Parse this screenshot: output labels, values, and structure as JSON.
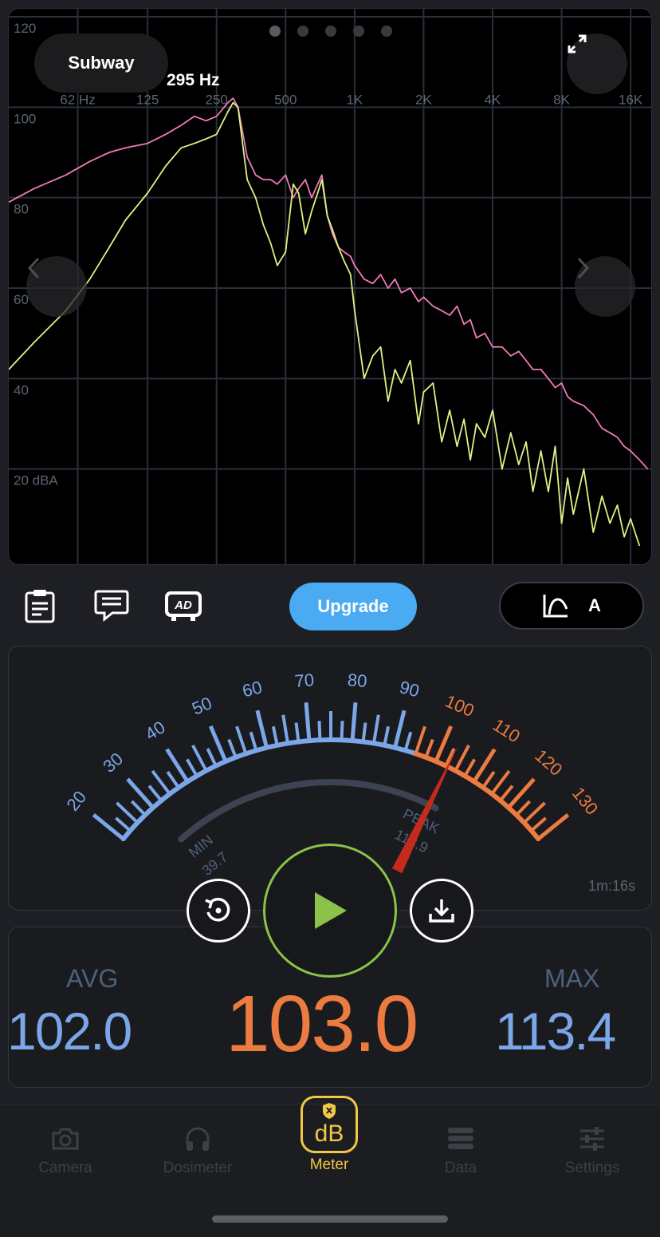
{
  "spectrum": {
    "location_label": "Subway",
    "peak_label": "295 Hz",
    "page_dots": 5,
    "active_dot": 0,
    "y_ticks": [
      "120",
      "100",
      "80",
      "60",
      "40",
      "20 dBA"
    ],
    "x_ticks": [
      "62 Hz",
      "125",
      "250",
      "500",
      "1K",
      "2K",
      "4K",
      "8K",
      "16K"
    ],
    "colors": {
      "max_line": "#f07ab8",
      "live_line": "#ddf383",
      "grid": "#2b2f3b",
      "labels": "#5c6472"
    },
    "chart_data": {
      "type": "line",
      "x_scale": "log",
      "xlim": [
        31,
        20000
      ],
      "ylim": [
        0,
        120
      ],
      "ylabel": "dBA",
      "series": [
        {
          "values_x": [
            31,
            40,
            55,
            70,
            85,
            100,
            125,
            150,
            175,
            200,
            225,
            250,
            280,
            295,
            310,
            340,
            370,
            400,
            430,
            460,
            500,
            540,
            570,
            610,
            650,
            690,
            720,
            760,
            800,
            850,
            900,
            960,
            1000,
            1100,
            1200,
            1300,
            1400,
            1500,
            1600,
            1750,
            1900,
            2000,
            2200,
            2400,
            2600,
            2800,
            3000,
            3200,
            3400,
            3700,
            4000,
            4400,
            4800,
            5200,
            5600,
            6000,
            6500,
            7000,
            7500,
            8000,
            8500,
            9000,
            10000,
            11000,
            12000,
            13000,
            14000,
            15000,
            16000,
            17500,
            19000
          ],
          "values_y": [
            79,
            82,
            85,
            88,
            90,
            91,
            92,
            94,
            96,
            98,
            97,
            98,
            101,
            102,
            100,
            89,
            85,
            84,
            84,
            83,
            85,
            80,
            82,
            84,
            80,
            83,
            85,
            76,
            72,
            69,
            68,
            67,
            65,
            62,
            61,
            63,
            60,
            62,
            59,
            60,
            57,
            58,
            56,
            55,
            54,
            56,
            52,
            53,
            49,
            50,
            47,
            47,
            45,
            46,
            44,
            42,
            42,
            40,
            38,
            39,
            36,
            35,
            34,
            32,
            29,
            28,
            27,
            25,
            24,
            22,
            20
          ]
        },
        {
          "values_x": [
            31,
            40,
            55,
            70,
            85,
            100,
            125,
            150,
            175,
            200,
            225,
            250,
            280,
            295,
            310,
            340,
            370,
            400,
            430,
            460,
            500,
            540,
            570,
            610,
            650,
            690,
            720,
            760,
            800,
            850,
            900,
            960,
            1000,
            1100,
            1200,
            1300,
            1400,
            1500,
            1600,
            1750,
            1900,
            2000,
            2200,
            2400,
            2600,
            2800,
            3000,
            3200,
            3400,
            3700,
            4000,
            4400,
            4800,
            5200,
            5600,
            6000,
            6500,
            7000,
            7500,
            8000,
            8500,
            9000,
            10000,
            11000,
            12000,
            13000,
            14000,
            15000,
            16000,
            17500
          ],
          "values_y": [
            42,
            48,
            55,
            62,
            69,
            75,
            81,
            87,
            91,
            92,
            93,
            94,
            99,
            101,
            100,
            84,
            80,
            74,
            70,
            65,
            68,
            83,
            81,
            72,
            77,
            81,
            84,
            76,
            73,
            69,
            66,
            63,
            55,
            40,
            45,
            47,
            35,
            42,
            39,
            44,
            30,
            37,
            39,
            26,
            33,
            25,
            31,
            22,
            30,
            27,
            33,
            20,
            28,
            21,
            26,
            15,
            24,
            15,
            25,
            8,
            18,
            10,
            20,
            6,
            14,
            8,
            12,
            5,
            9,
            3
          ]
        }
      ]
    }
  },
  "toolbar": {
    "upgrade_label": "Upgrade",
    "weighting_label": "A"
  },
  "gauge": {
    "scale_labels": [
      "20",
      "30",
      "40",
      "50",
      "60",
      "70",
      "80",
      "90",
      "100",
      "110",
      "120",
      "130"
    ],
    "min_label": "MIN",
    "min_value": "39.7",
    "peak_label": "PEAK",
    "peak_value": "113.9",
    "needle_value": 103.0,
    "elapsed": "1m:16s",
    "colors": {
      "low": "#7ba6e8",
      "high": "#ec7b41",
      "needle": "#c42b1c",
      "track": "#3d4352"
    }
  },
  "controls": {
    "play_color": "#8bc34a"
  },
  "stats": {
    "avg_label": "AVG",
    "avg_value": "102.0",
    "current_value": "103.0",
    "max_label": "MAX",
    "max_value": "113.4"
  },
  "tabs": [
    {
      "label": "Camera",
      "icon": "camera-icon"
    },
    {
      "label": "Dosimeter",
      "icon": "headphones-icon"
    },
    {
      "label": "Meter",
      "icon": "db-meter-icon",
      "active": true
    },
    {
      "label": "Data",
      "icon": "database-icon"
    },
    {
      "label": "Settings",
      "icon": "sliders-icon"
    }
  ],
  "active_tab_color": "#f2c744"
}
